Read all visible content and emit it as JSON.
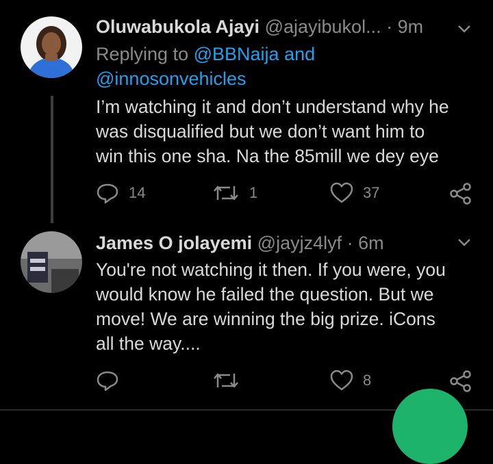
{
  "tweets": [
    {
      "name": "Oluwabukola Ajayi",
      "handle": "@ajayibukol...",
      "dot": "·",
      "time": "9m",
      "replying_prefix": "Replying to",
      "mention1": "@BBNaija and",
      "mention2": "@innosonvehicles",
      "lines": [
        "I’m watching it and don’t understand why he",
        "was disqualified but we don’t want him to",
        "win this one sha. Na the 85mill we dey eye"
      ],
      "replies": "14",
      "retweets": "1",
      "likes": "37",
      "avatar_icon": "woman-avatar"
    },
    {
      "name": "James O jolayemi",
      "handle": "@jayjz4lyf",
      "dot": "·",
      "time": "6m",
      "lines": [
        "You're not watching it then. If you were, you",
        "would know he failed the question. But we",
        "move! We are winning the big prize. iCons",
        "all the way...."
      ],
      "replies": "",
      "retweets": "",
      "likes": "8",
      "avatar_icon": "person-avatar"
    }
  ],
  "colors": {
    "background": "#000000",
    "text": "#d9d9d9",
    "muted": "#8a8a8a",
    "mention": "#1da1f2",
    "fab": "#1db36a"
  },
  "icons": [
    "reply-icon",
    "retweet-icon",
    "like-icon",
    "share-icon",
    "chevron-down-icon"
  ]
}
